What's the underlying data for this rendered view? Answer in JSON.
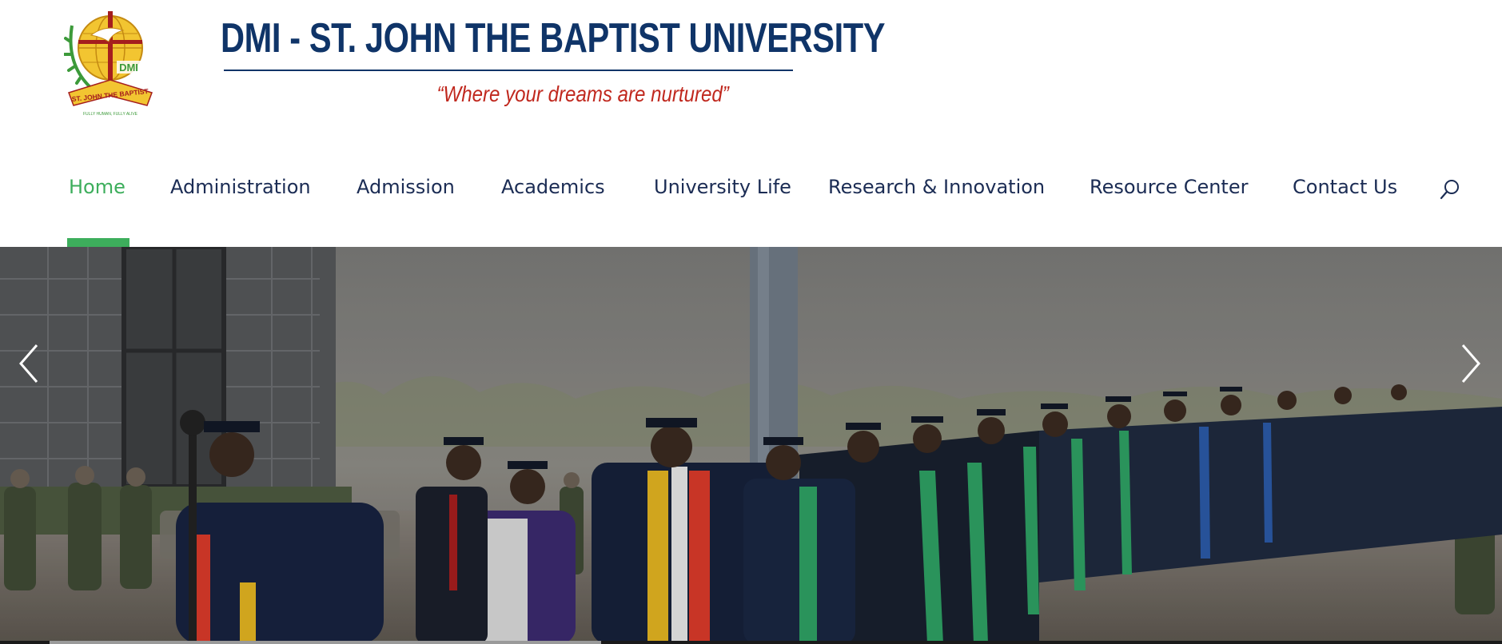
{
  "header": {
    "university_name": "DMI - ST. JOHN THE BAPTIST UNIVERSITY",
    "tagline": "“Where your dreams are nurtured”",
    "seal": {
      "ring_text": "ST. JOHN THE BAPTIST",
      "badge_text": "DMI",
      "motto": "FULLY HUMAN, FULLY ALIVE"
    }
  },
  "nav": {
    "items": [
      {
        "label": "Home",
        "active": true
      },
      {
        "label": "Administration",
        "active": false
      },
      {
        "label": "Admission",
        "active": false
      },
      {
        "label": "Academics",
        "active": false
      },
      {
        "label": "University Life",
        "active": false
      },
      {
        "label": "Research & Innovation",
        "active": false
      },
      {
        "label": "Resource Center",
        "active": false
      },
      {
        "label": "Contact Us",
        "active": false
      }
    ],
    "search_icon": "search-icon"
  },
  "hero": {
    "slide_alt": "graduation-procession-photo",
    "prev_icon": "chevron-left-icon",
    "next_icon": "chevron-right-icon",
    "progress": 0.38
  },
  "colors": {
    "brand_navy": "#0f3468",
    "tagline_red": "#c0281e",
    "accent_green": "#3dae5c",
    "nav_text": "#1b2c54"
  }
}
